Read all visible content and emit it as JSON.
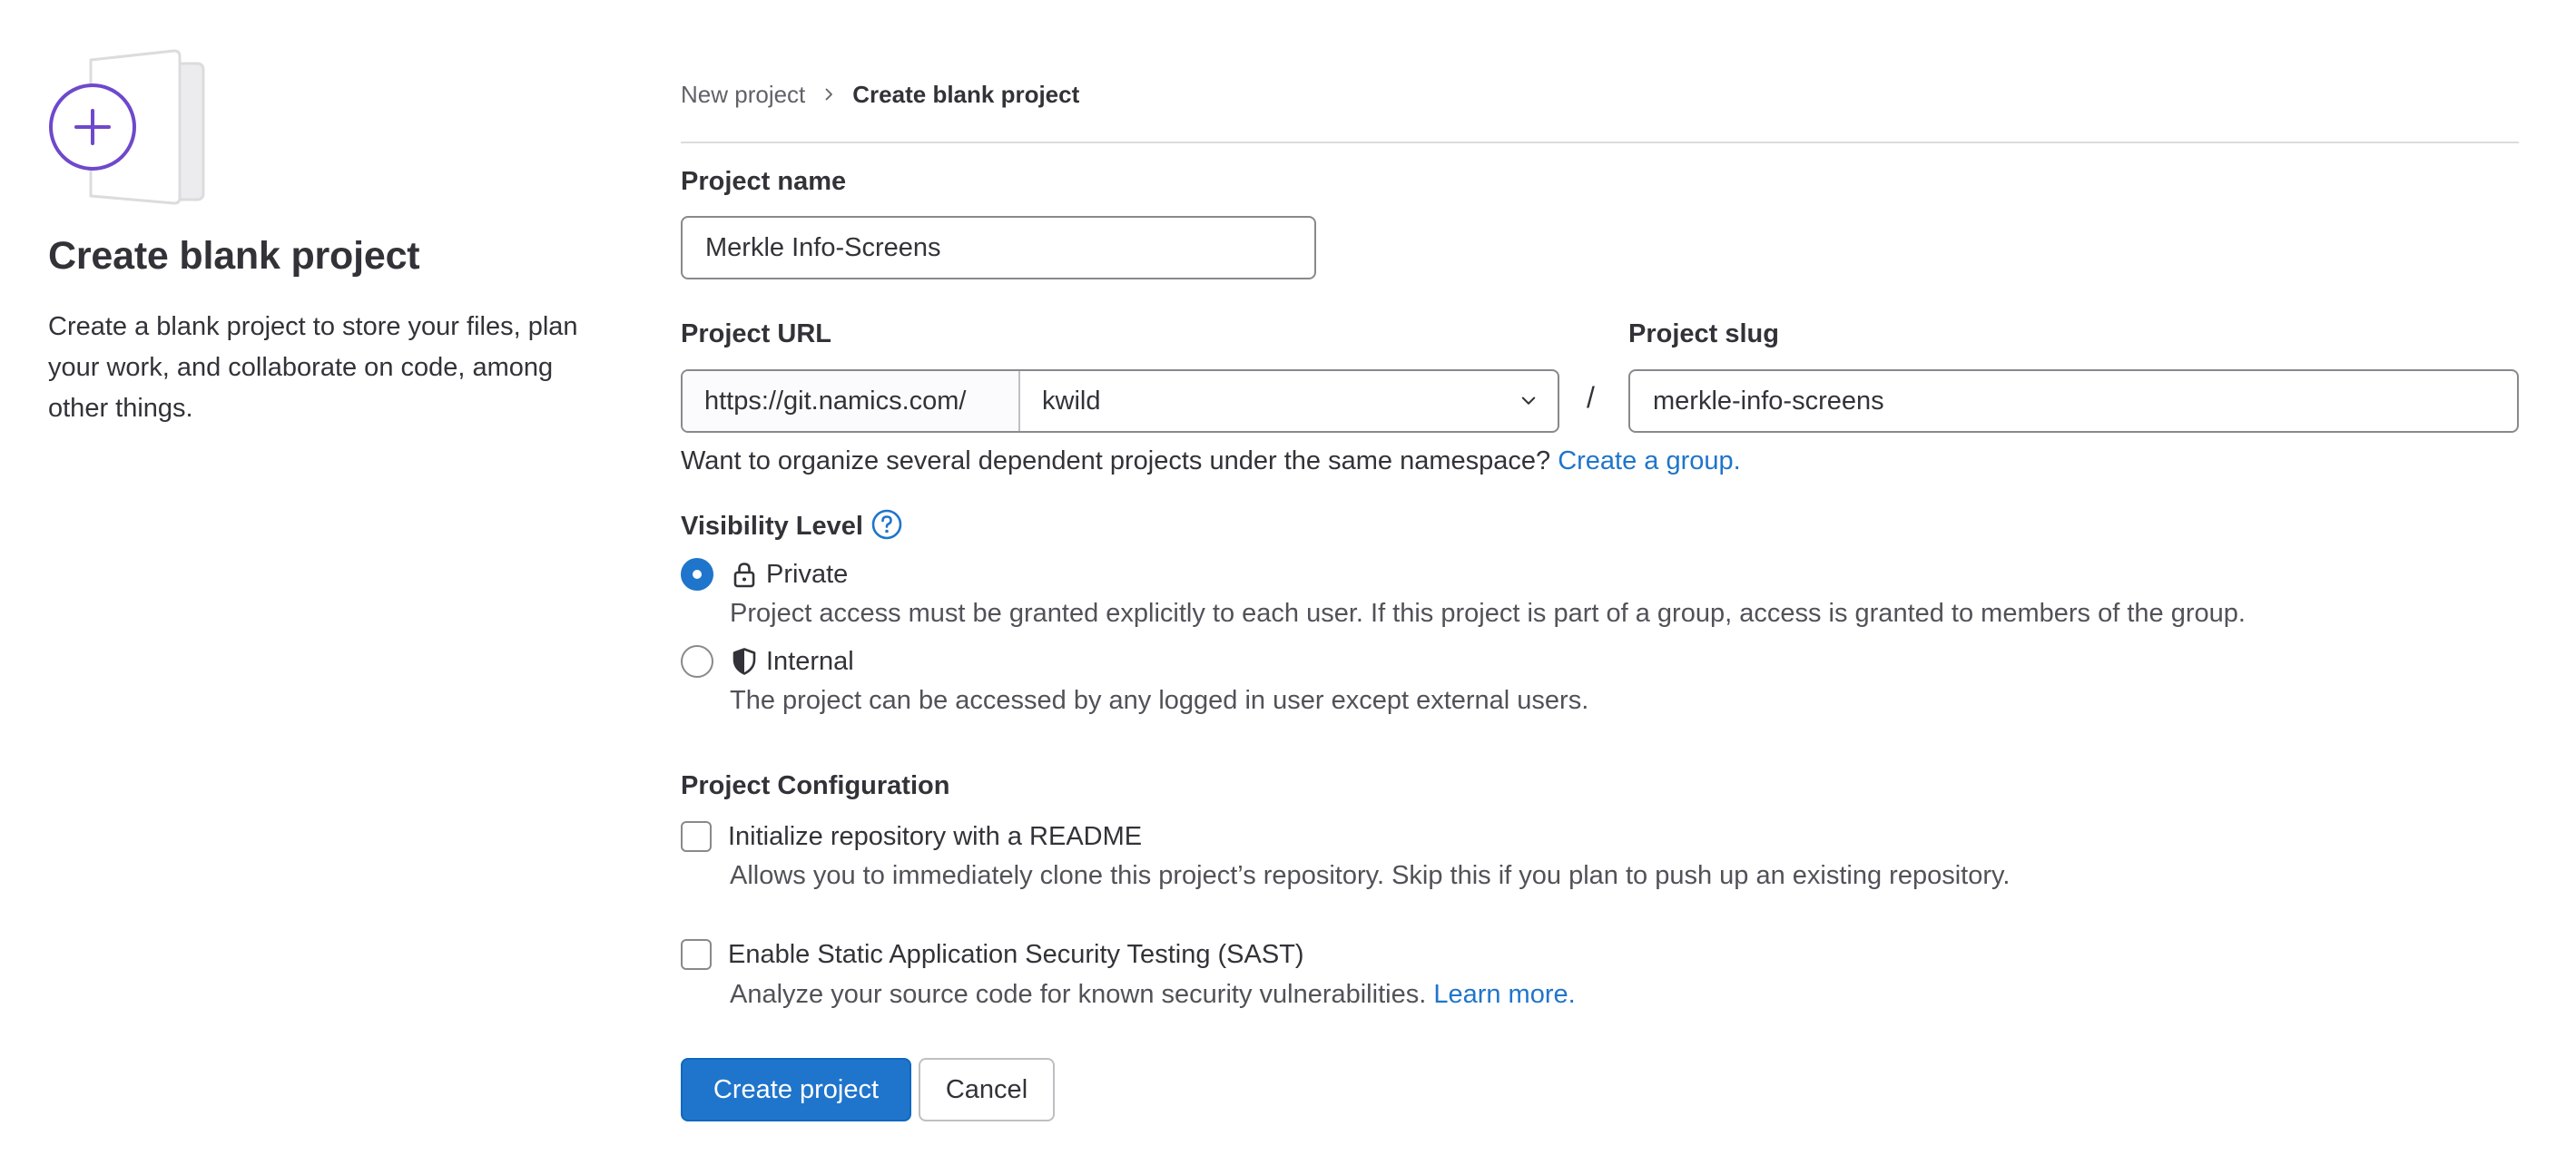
{
  "colors": {
    "accent": "#1f75cb",
    "illustration_purple": "#6e49cb",
    "border": "#89888d",
    "divider": "#dcdcde",
    "text": "#333238"
  },
  "sidebar": {
    "illustration_icon": "plus-circle-document-illustration",
    "title": "Create blank project",
    "description": "Create a blank project to store your files, plan your work, and collaborate on code, among other things."
  },
  "breadcrumb": {
    "parent": "New project",
    "separator_icon": "chevron-right-icon",
    "current": "Create blank project"
  },
  "form": {
    "project_name": {
      "label": "Project name",
      "value": "Merkle Info-Screens"
    },
    "project_url": {
      "label": "Project URL",
      "prefix": "https://git.namics.com/",
      "namespace": "kwild",
      "separator": "/"
    },
    "project_slug": {
      "label": "Project slug",
      "value": "merkle-info-screens"
    },
    "namespace_help": {
      "text": "Want to organize several dependent projects under the same namespace?",
      "link": "Create a group."
    },
    "visibility": {
      "label": "Visibility Level",
      "help_icon": "question-circle-icon",
      "options": [
        {
          "label": "Private",
          "icon": "lock-icon",
          "checked": true,
          "description": "Project access must be granted explicitly to each user. If this project is part of a group, access is granted to members of the group."
        },
        {
          "label": "Internal",
          "icon": "shield-icon",
          "checked": false,
          "description": "The project can be accessed by any logged in user except external users."
        }
      ]
    },
    "configuration": {
      "label": "Project Configuration",
      "options": [
        {
          "label": "Initialize repository with a README",
          "checked": false,
          "description": "Allows you to immediately clone this project’s repository. Skip this if you plan to push up an existing repository."
        },
        {
          "label": "Enable Static Application Security Testing (SAST)",
          "checked": false,
          "description": "Analyze your source code for known security vulnerabilities.",
          "link": "Learn more."
        }
      ]
    },
    "actions": {
      "submit": "Create project",
      "cancel": "Cancel"
    }
  }
}
